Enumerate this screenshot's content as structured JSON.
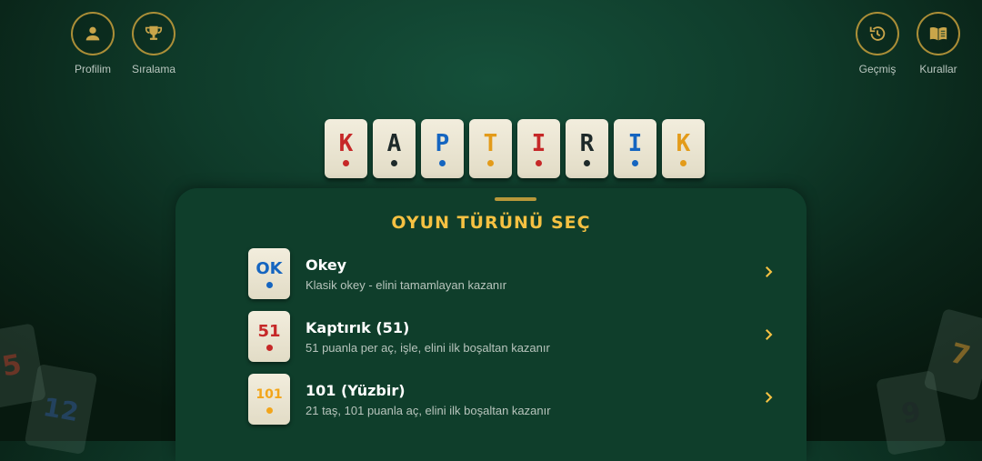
{
  "header": {
    "left": [
      {
        "label": "Profilim",
        "icon": "person-icon"
      },
      {
        "label": "Sıralama",
        "icon": "trophy-icon"
      }
    ],
    "right": [
      {
        "label": "Geçmiş",
        "icon": "history-icon"
      },
      {
        "label": "Kurallar",
        "icon": "book-icon"
      }
    ]
  },
  "logo": {
    "tiles": [
      {
        "letter": "K",
        "color": "#c62828"
      },
      {
        "letter": "A",
        "color": "#1e2a2a"
      },
      {
        "letter": "P",
        "color": "#1565c0"
      },
      {
        "letter": "T",
        "color": "#e39b1a"
      },
      {
        "letter": "I",
        "color": "#c62828"
      },
      {
        "letter": "R",
        "color": "#1e2a2a"
      },
      {
        "letter": "I",
        "color": "#1565c0"
      },
      {
        "letter": "K",
        "color": "#e39b1a"
      }
    ]
  },
  "panel": {
    "title": "OYUN TÜRÜNÜ SEÇ",
    "modes": [
      {
        "icon_text": "OK",
        "icon_color": "#1565c0",
        "title": "Okey",
        "subtitle": "Klasik okey - elini tamamlayan kazanır"
      },
      {
        "icon_text": "51",
        "icon_color": "#c62828",
        "title": "Kaptırık (51)",
        "subtitle": "51 puanla per aç, işle, elini ilk boşaltan kazanır"
      },
      {
        "icon_text": "101",
        "icon_color": "#f2a51a",
        "title": "101 (Yüzbir)",
        "subtitle": "21 taş, 101 puanla aç, elini ilk boşaltan kazanır"
      }
    ]
  },
  "decor_tiles": [
    "5",
    "12",
    "7",
    "9"
  ],
  "colors": {
    "accent": "#f5c142",
    "panel": "#0f3e2b",
    "background": "#0c2d1f"
  }
}
